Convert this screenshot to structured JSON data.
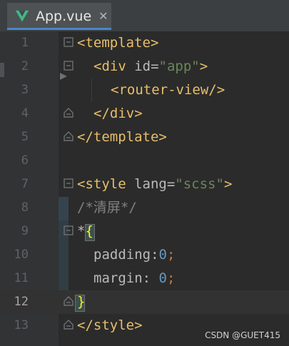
{
  "tab": {
    "title": "App.vue",
    "close_icon": "close-icon",
    "file_icon": "vue-icon"
  },
  "editor": {
    "current_line": 12,
    "lines": [
      {
        "n": "1"
      },
      {
        "n": "2"
      },
      {
        "n": "3"
      },
      {
        "n": "4"
      },
      {
        "n": "5"
      },
      {
        "n": "6"
      },
      {
        "n": "7"
      },
      {
        "n": "8"
      },
      {
        "n": "9"
      },
      {
        "n": "10"
      },
      {
        "n": "11"
      },
      {
        "n": "12"
      },
      {
        "n": "13"
      }
    ],
    "code": {
      "l1_open": "<template>",
      "l2_div_open": "<div ",
      "l2_attr": "id",
      "l2_eq": "=",
      "l2_val": "\"app\"",
      "l2_close": ">",
      "l3": "<router-view/>",
      "l4": "</div>",
      "l5": "</template>",
      "l7_open": "<style ",
      "l7_attr": "lang",
      "l7_eq": "=",
      "l7_val": "\"scss\"",
      "l7_close": ">",
      "l8": "/*清屏*/",
      "l9_star": "*",
      "l9_brace": "{",
      "l10_prop": "padding",
      "l10_colon": ":",
      "l10_num": "0",
      "l10_semi": ";",
      "l11_prop": "margin",
      "l11_colon": ": ",
      "l11_num": "0",
      "l11_semi": ";",
      "l12_brace": "}",
      "l13": "</style>"
    }
  },
  "watermark": "CSDN @GUET415",
  "colors": {
    "background": "#2b2b2b",
    "gutter": "#313335",
    "tag": "#e8bf6a",
    "string": "#6a8759",
    "comment": "#808080",
    "number": "#6897bb",
    "punctuation": "#cc7832",
    "brace_match": "#ffef28",
    "tab_underline": "#4a88c7"
  }
}
